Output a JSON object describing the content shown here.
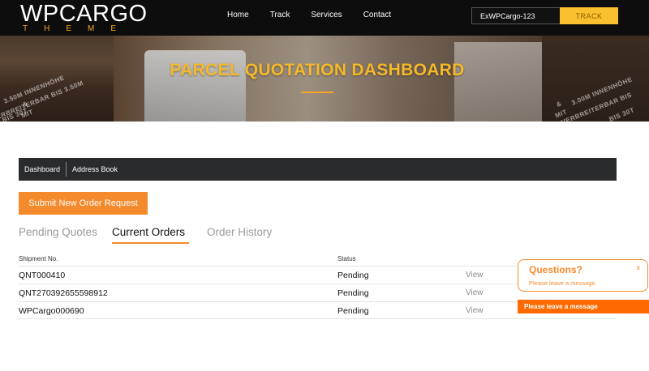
{
  "header": {
    "logo_main": "WPCARGO",
    "logo_sub": "THEME",
    "nav": [
      "Home",
      "Track",
      "Services",
      "Contact"
    ],
    "track_input_value": "ExWPCargo-123",
    "track_button": "TRACK"
  },
  "banner": {
    "title": "PARCEL QUOTATION DASHBOARD",
    "trailer_text_left": [
      "3.50M INNENHÖHE",
      "&",
      "ERBREITERBAR BIS 3.50M",
      "MIT",
      "BIS 30T"
    ],
    "trailer_text_right": [
      "3.00M INNENHÖHE",
      "&",
      "VERBREITERBAR BIS 3.5M",
      "MIT",
      "BIS 30T"
    ]
  },
  "dashboard_nav": [
    "Dashboard",
    "Address Book"
  ],
  "submit_button": "Submit New Order Request",
  "tabs": [
    {
      "label": "Pending Quotes",
      "active": false
    },
    {
      "label": "Current Orders",
      "active": true
    },
    {
      "label": "Order History",
      "active": false
    }
  ],
  "table": {
    "headers": {
      "shipment": "Shipment No.",
      "status": "Status"
    },
    "rows": [
      {
        "shipment": "QNT000410",
        "status": "Pending",
        "action": "View"
      },
      {
        "shipment": "QNT270392655598912",
        "status": "Pending",
        "action": "View"
      },
      {
        "shipment": "WPCargo000690",
        "status": "Pending",
        "action": "View"
      }
    ]
  },
  "chat": {
    "title": "Questions?",
    "subtitle": "Please leave a message",
    "close": "x",
    "bar_label": "Please leave a message"
  },
  "colors": {
    "accent_orange": "#f58a2c",
    "accent_yellow": "#fbc02d",
    "header_bg": "#0d0d0d",
    "dash_nav_bg": "#2a2b2d"
  }
}
